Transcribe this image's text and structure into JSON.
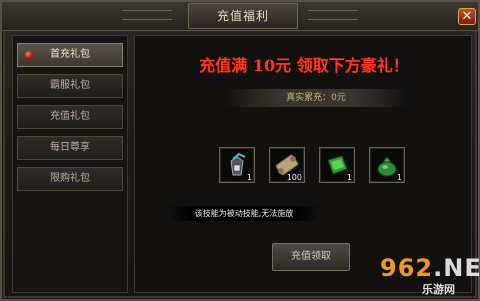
{
  "window": {
    "title": "充值福利",
    "close_glyph": "✕"
  },
  "sidebar": {
    "items": [
      {
        "label": "首充礼包",
        "active": true
      },
      {
        "label": "霸服礼包",
        "active": false
      },
      {
        "label": "充值礼包",
        "active": false
      },
      {
        "label": "每日尊享",
        "active": false
      },
      {
        "label": "限购礼包",
        "active": false
      }
    ]
  },
  "panel": {
    "headline_a": "充值满",
    "headline_amount": "10元",
    "headline_b": "领取下方豪礼！",
    "recharge_text": "真实累充：0元",
    "rewards": [
      {
        "icon": "gem-bag-icon",
        "qty": "1"
      },
      {
        "icon": "scroll-icon",
        "qty": "100"
      },
      {
        "icon": "skill-book-icon",
        "qty": "1"
      },
      {
        "icon": "coin-pouch-icon",
        "qty": "1"
      }
    ],
    "message": "该技能为被动技能,无法施放",
    "claim_label": "充值领取"
  },
  "watermark": {
    "brand_a": "962",
    "brand_b": ".NET",
    "sub": "乐游网"
  }
}
